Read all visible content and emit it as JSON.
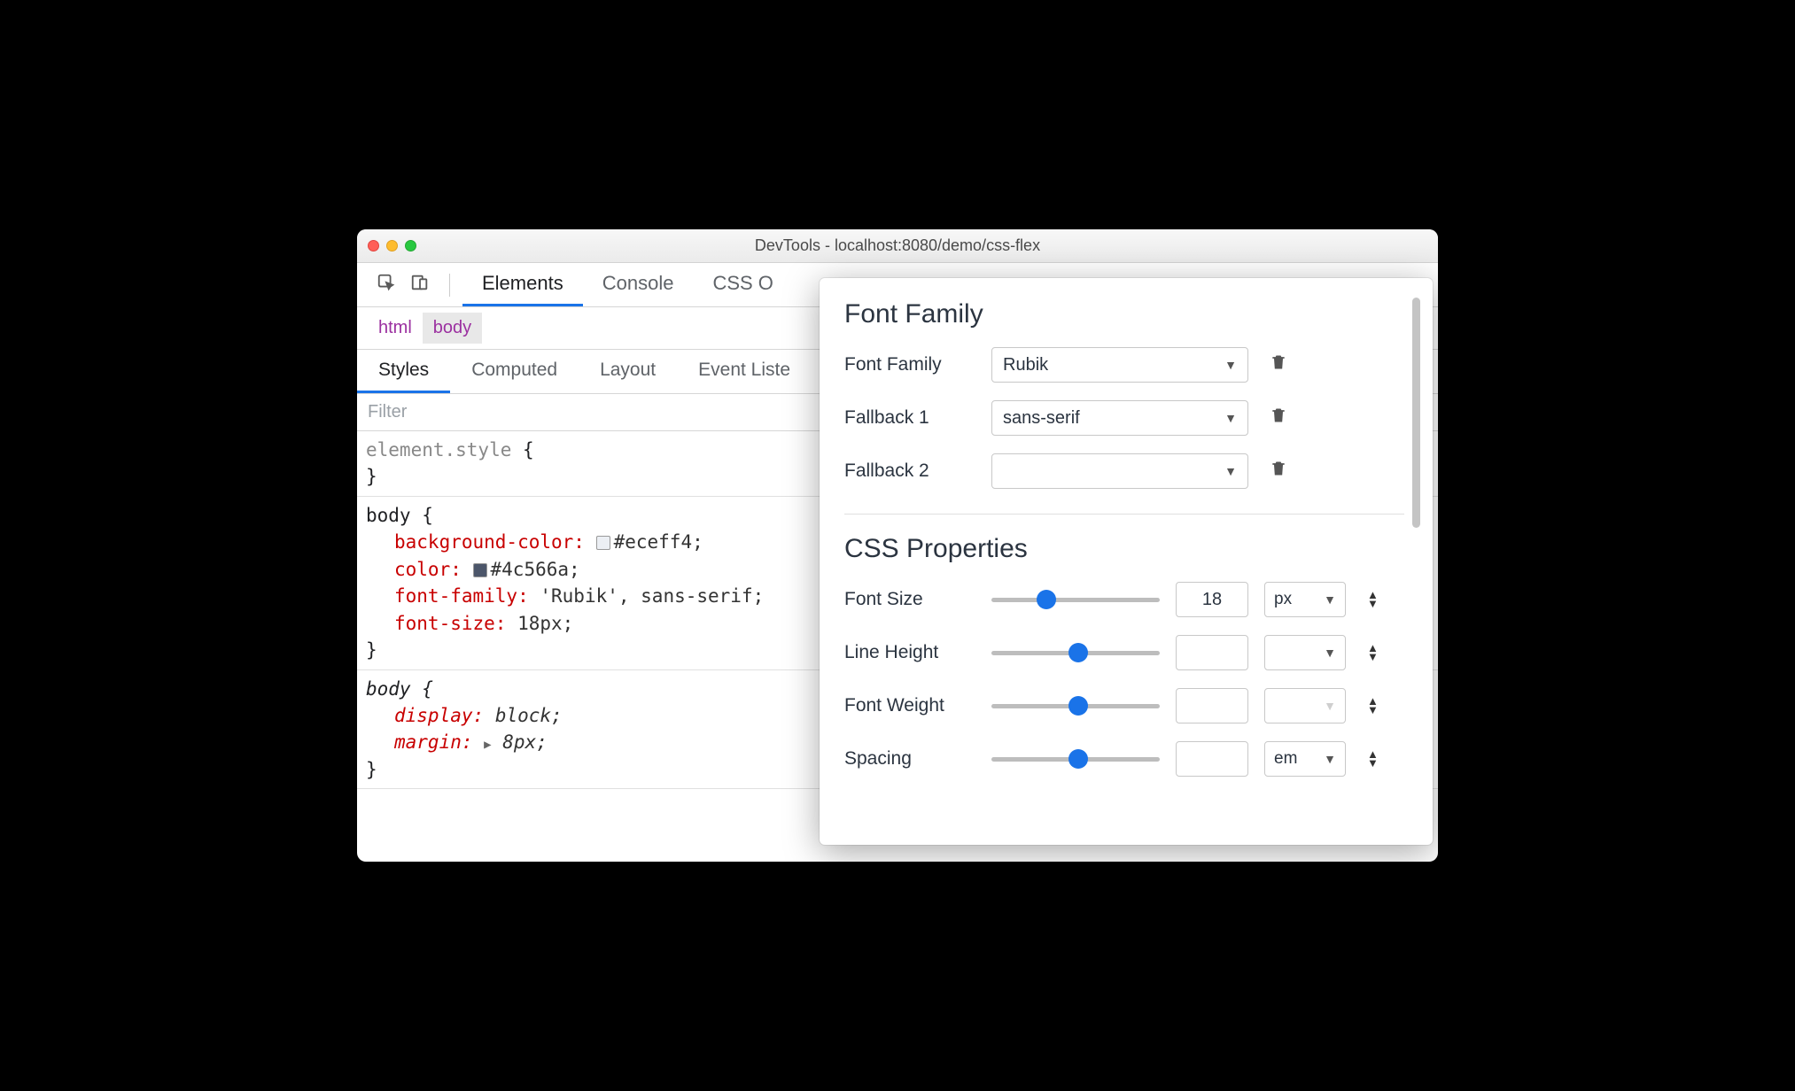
{
  "window": {
    "title": "DevTools - localhost:8080/demo/css-flex"
  },
  "main_tabs": {
    "elements": "Elements",
    "console": "Console",
    "css": "CSS O"
  },
  "breadcrumbs": {
    "html": "html",
    "body": "body"
  },
  "sub_tabs": {
    "styles": "Styles",
    "computed": "Computed",
    "layout": "Layout",
    "event_listeners": "Event Liste"
  },
  "filter": {
    "placeholder": "Filter"
  },
  "css": {
    "block0": {
      "selector": "element.style",
      "open": "{",
      "close": "}"
    },
    "block1": {
      "selector": "body",
      "open": "{",
      "close": "}",
      "p1k": "background-color",
      "p1v": "#eceff4",
      "p2k": "color",
      "p2v": "#4c566a",
      "p3k": "font-family",
      "p3v": "'Rubik', sans-serif",
      "p4k": "font-size",
      "p4v": "18px"
    },
    "block2": {
      "selector": "body",
      "open": "{",
      "close": "}",
      "p1k": "display",
      "p1v": "block",
      "p2k": "margin",
      "p2v": "8px"
    }
  },
  "popover": {
    "font_family": {
      "heading": "Font Family",
      "rows": {
        "r1_label": "Font Family",
        "r1_value": "Rubik",
        "r2_label": "Fallback 1",
        "r2_value": "sans-serif",
        "r3_label": "Fallback 2",
        "r3_value": ""
      }
    },
    "css_props": {
      "heading": "CSS Properties",
      "rows": {
        "font_size_label": "Font Size",
        "font_size_value": "18",
        "font_size_unit": "px",
        "line_height_label": "Line Height",
        "line_height_value": "",
        "line_height_unit": "",
        "font_weight_label": "Font Weight",
        "font_weight_value": "",
        "font_weight_unit": "",
        "spacing_label": "Spacing",
        "spacing_value": "",
        "spacing_unit": "em"
      },
      "slider_pos": {
        "font_size": "27%",
        "line_height": "46%",
        "font_weight": "46%",
        "spacing": "46%"
      }
    }
  },
  "colors": {
    "bg_swatch": "#eceff4",
    "fg_swatch": "#4c566a"
  }
}
